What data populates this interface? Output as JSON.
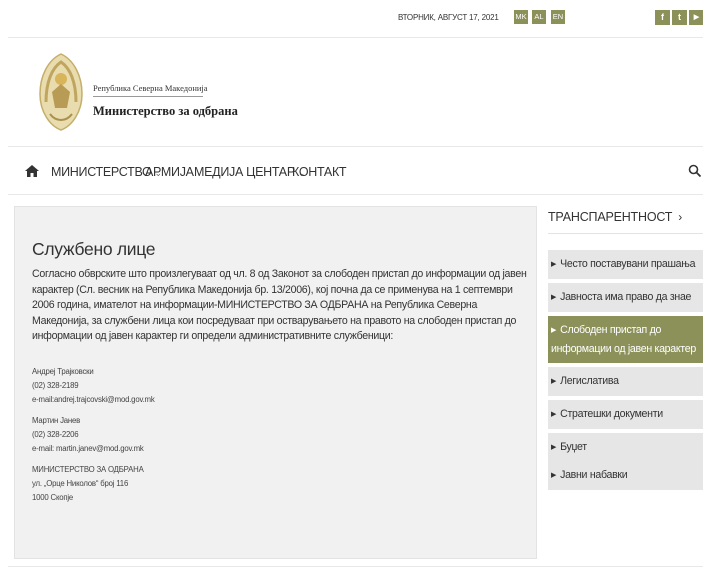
{
  "topbar": {
    "date": "ВТОРНИК, АВГУСТ 17, 2021",
    "languages": [
      "MK",
      "AL",
      "EN"
    ],
    "social": [
      {
        "icon": "facebook-icon",
        "glyph": "f"
      },
      {
        "icon": "twitter-icon",
        "glyph": "t"
      },
      {
        "icon": "youtube-icon",
        "glyph": "▶"
      }
    ]
  },
  "brand": {
    "subtitle": "Република Северна Македонија",
    "title": "Министерство за одбрана"
  },
  "nav": {
    "home_icon": "home-icon",
    "items": [
      {
        "label": "МИНИСТЕРСТВО",
        "dropdown": true
      },
      {
        "label": "АРМИЈА",
        "dropdown": false
      },
      {
        "label": "МЕДИЈА ЦЕНТАР",
        "dropdown": true
      },
      {
        "label": "КОНТАКТ",
        "dropdown": false
      }
    ],
    "search_icon": "search-icon"
  },
  "main": {
    "title": "Службено лице",
    "intro": "Согласно обврските што произлегуваат од чл. 8 од Законот за слободен пристап до информации од јавен карактер (Сл. весник на Република Македонија бр. 13/2006), кој почна да се применува на 1 септември 2006 година, имателот на информации-МИНИСТЕРСТВО ЗА ОДБРАНА на Република Северна Македонија, за службени лица кои посредуваат при остварувањето на правото на слободен пристап до информации од јавен карактер ги определи административните службеници:",
    "contacts": [
      {
        "name": "Андреј Трајковски",
        "phone": "(02) 328-2189",
        "email": "e-mail:andrej.trajcovski@mod.gov.mk"
      },
      {
        "name": "Мартин Јанев",
        "phone": "(02) 328-2206",
        "email": "e-mail: martin.janev@mod.gov.mk"
      }
    ],
    "address": {
      "org": "МИНИСТЕРСТВО ЗА ОДБРАНА",
      "street": "ул. „Орце Николов“ број 116",
      "city": "1000 Скопје"
    }
  },
  "sidebar": {
    "title": "ТРАНСПАРЕНТНОСТ",
    "items": [
      {
        "label": "Често поставувани прашања",
        "active": false
      },
      {
        "label": "Јавноста има право да знае",
        "active": false
      },
      {
        "label": "Слободен пристап до информации од јавен карактер",
        "active": true
      },
      {
        "label": "Легислатива",
        "active": false
      },
      {
        "label": "Стратешки документи",
        "active": false
      },
      {
        "label": "Буџет",
        "active": false
      },
      {
        "label": "Јавни набавки",
        "active": false
      }
    ]
  },
  "colors": {
    "accent": "#8c915a",
    "panel": "#f1f1f1",
    "sidebar_item": "#e6e6e6"
  }
}
